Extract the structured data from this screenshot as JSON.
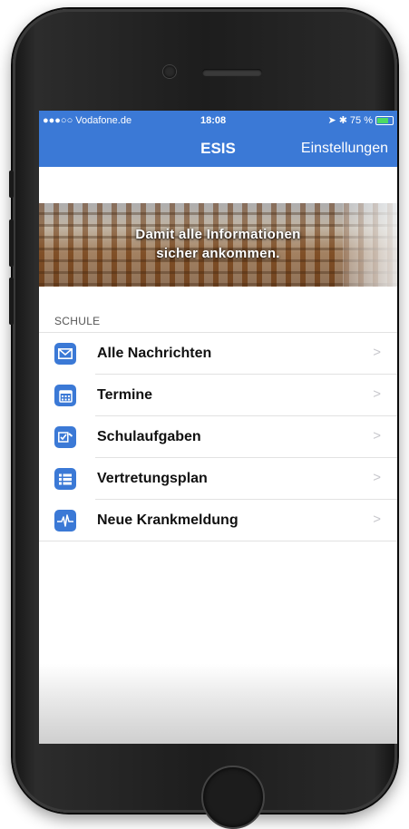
{
  "status_bar": {
    "carrier": "●●●○○ Vodafone.de",
    "time": "18:08",
    "battery": "75 %",
    "battery_level": 0.75
  },
  "nav": {
    "title": "ESIS",
    "settings_label": "Einstellungen"
  },
  "banner": {
    "line1": "Damit alle Informationen",
    "line2": "sicher ankommen."
  },
  "section": {
    "header": "SCHULE"
  },
  "menu": {
    "items": [
      {
        "label": "Alle Nachrichten",
        "icon": "envelope-icon"
      },
      {
        "label": "Termine",
        "icon": "calendar-icon"
      },
      {
        "label": "Schulaufgaben",
        "icon": "checklist-icon"
      },
      {
        "label": "Vertretungsplan",
        "icon": "list-icon"
      },
      {
        "label": "Neue Krankmeldung",
        "icon": "heartbeat-icon"
      }
    ],
    "chevron": ">"
  },
  "colors": {
    "accent": "#3b79d6"
  }
}
